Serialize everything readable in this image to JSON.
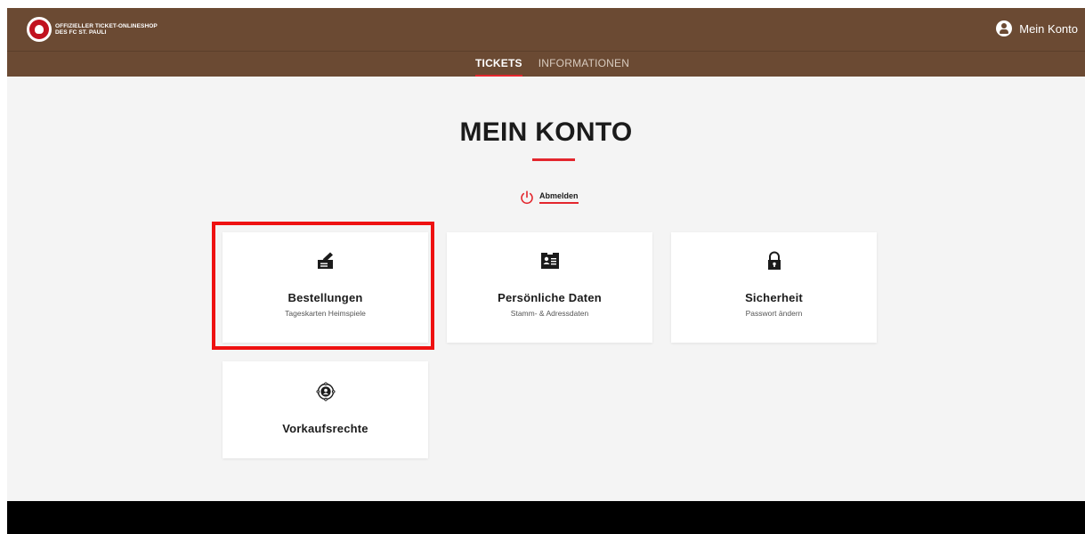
{
  "header": {
    "logo_line1": "OFFIZIELLER TICKET-ONLINESHOP",
    "logo_line2": "DES FC ST. PAULI",
    "account_label": "Mein Konto"
  },
  "nav": {
    "items": [
      {
        "label": "TICKETS",
        "active": true
      },
      {
        "label": "INFORMATIONEN",
        "active": false
      }
    ]
  },
  "main": {
    "title": "MEIN KONTO",
    "logout_label": "Abmelden",
    "cards": [
      {
        "title": "Bestellungen",
        "subtitle": "Tageskarten Heimspiele",
        "icon": "ticket-pen-icon",
        "highlighted": true
      },
      {
        "title": "Persönliche Daten",
        "subtitle": "Stamm- & Adressdaten",
        "icon": "id-card-icon"
      },
      {
        "title": "Sicherheit",
        "subtitle": "Passwort ändern",
        "icon": "lock-icon"
      },
      {
        "title": "Vorkaufsrechte",
        "subtitle": "",
        "icon": "user-target-icon"
      }
    ]
  },
  "colors": {
    "header_brown": "#6b4a33",
    "accent_red": "#e3262d",
    "highlight_red": "#ee1111",
    "page_bg": "#f4f4f4",
    "footer": "#000000"
  }
}
